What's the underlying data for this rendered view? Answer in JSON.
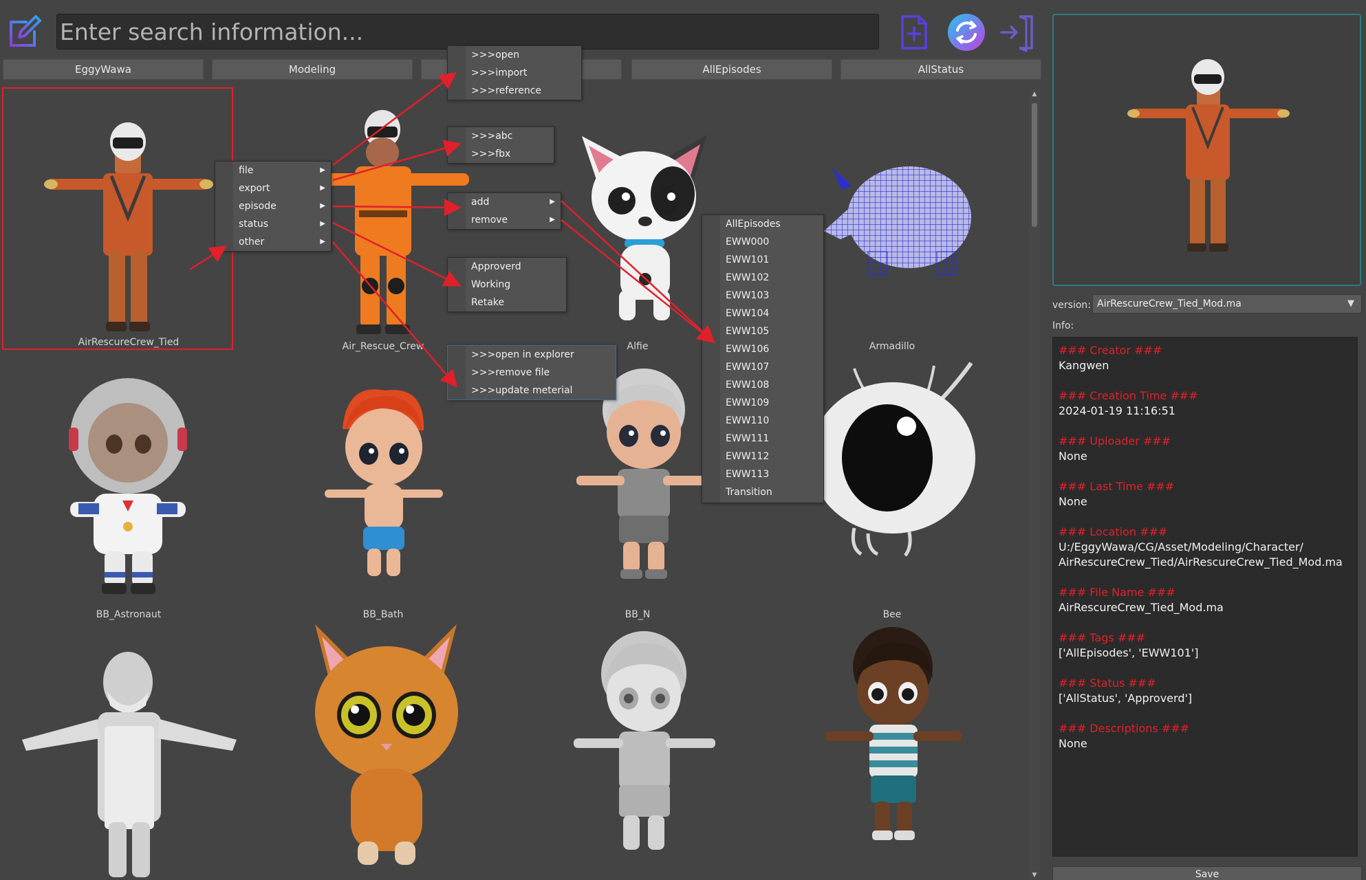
{
  "search": {
    "placeholder": "Enter search information..."
  },
  "filters": [
    "EggyWawa",
    "Modeling",
    "",
    "AllEpisodes",
    "AllStatus"
  ],
  "assets": [
    {
      "name": "AirRescureCrew_Tied"
    },
    {
      "name": "Air_Rescue_Crew"
    },
    {
      "name": "Alfie"
    },
    {
      "name": "Armadillo"
    },
    {
      "name": "BB_Astronaut"
    },
    {
      "name": "BB_Bath"
    },
    {
      "name": "BB_N"
    },
    {
      "name": "Bee"
    },
    {
      "name": ""
    },
    {
      "name": ""
    },
    {
      "name": ""
    },
    {
      "name": ""
    }
  ],
  "context_menu": [
    "file",
    "export",
    "episode",
    "status",
    "other"
  ],
  "file_menu": [
    ">>>open",
    ">>>import",
    ">>>reference"
  ],
  "export_menu": [
    ">>>abc",
    ">>>fbx"
  ],
  "episode_menu": [
    "add",
    "remove"
  ],
  "status_menu": [
    "Approverd",
    "Working",
    "Retake"
  ],
  "other_menu": [
    ">>>open in explorer",
    ">>>remove file",
    ">>>update meterial"
  ],
  "episodes_list": [
    "AllEpisodes",
    "EWW000",
    "EWW101",
    "EWW102",
    "EWW103",
    "EWW104",
    "EWW105",
    "EWW106",
    "EWW107",
    "EWW108",
    "EWW109",
    "EWW110",
    "EWW111",
    "EWW112",
    "EWW113",
    "Transition"
  ],
  "version": {
    "label": "version:",
    "value": "AirRescureCrew_Tied_Mod.ma"
  },
  "info": {
    "label": "Info:",
    "fields": [
      {
        "header": "### Creator ###",
        "value": "Kangwen"
      },
      {
        "header": "### Creation Time ###",
        "value": "2024-01-19 11:16:51"
      },
      {
        "header": "### Uploader ###",
        "value": "None"
      },
      {
        "header": "### Last Time ###",
        "value": "None"
      },
      {
        "header": "### Location ###",
        "value": "U:/EggyWawa/CG/Asset/Modeling/Character/\nAirRescureCrew_Tied/AirRescureCrew_Tied_Mod.ma"
      },
      {
        "header": "### File Name ###",
        "value": "AirRescureCrew_Tied_Mod.ma"
      },
      {
        "header": "### Tags ###",
        "value": "['AllEpisodes', 'EWW101']"
      },
      {
        "header": "### Status ###",
        "value": "['AllStatus', 'Approverd']"
      },
      {
        "header": "### Descriptions ###",
        "value": "None"
      }
    ]
  },
  "save_label": "Save",
  "colors": {
    "accent_red": "#e0202a",
    "preview_border": "#2a7d86",
    "logo": "#7b3fe4"
  }
}
